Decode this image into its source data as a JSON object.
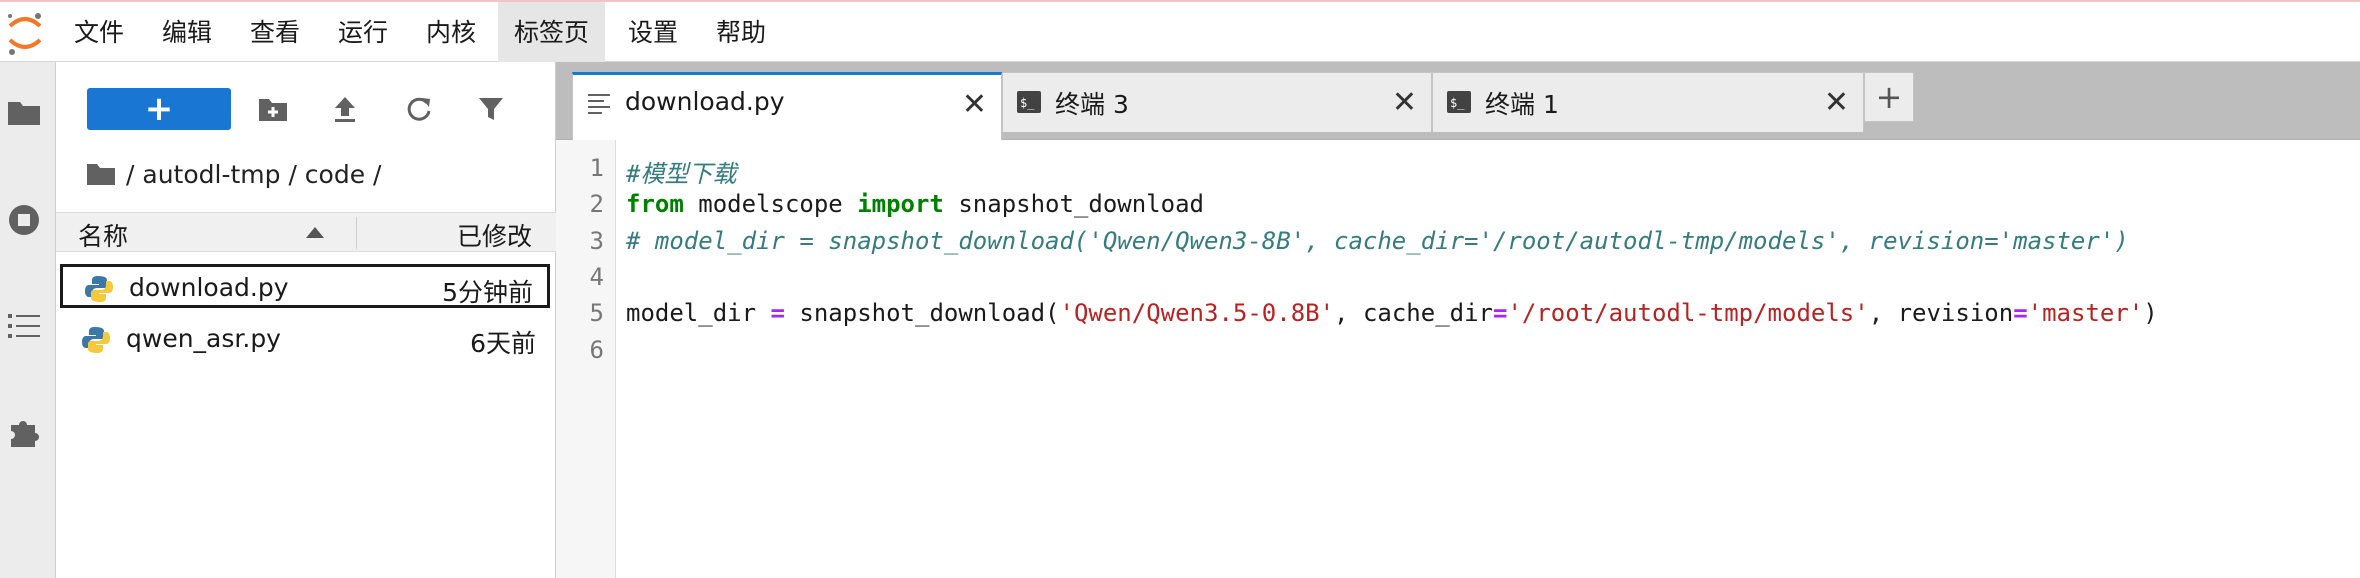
{
  "menubar": {
    "items": [
      "文件",
      "编辑",
      "查看",
      "运行",
      "内核",
      "标签页",
      "设置",
      "帮助"
    ],
    "active_index": 5
  },
  "filebrowser": {
    "new_button_label": "+",
    "breadcrumb": "/ autodl-tmp / code /",
    "header": {
      "name": "名称",
      "modified": "已修改"
    },
    "files": [
      {
        "name": "download.py",
        "modified": "5分钟前",
        "icon": "python-icon",
        "selected": true
      },
      {
        "name": "qwen_asr.py",
        "modified": "6天前",
        "icon": "python-icon",
        "selected": false
      }
    ]
  },
  "tabs": [
    {
      "label": "download.py",
      "icon": "text-file-icon",
      "active": true
    },
    {
      "label": "终端 3",
      "icon": "terminal-icon",
      "active": false
    },
    {
      "label": "终端 1",
      "icon": "terminal-icon",
      "active": false
    }
  ],
  "tab_close_glyph": "✕",
  "tab_add_glyph": "+",
  "editor": {
    "line_numbers": [
      "1",
      "2",
      "3",
      "4",
      "5",
      "6"
    ],
    "lines": [
      {
        "parts": [
          {
            "t": "#模型下载",
            "c": "comment"
          }
        ]
      },
      {
        "parts": [
          {
            "t": "from",
            "c": "kw"
          },
          {
            "t": " modelscope ",
            "c": ""
          },
          {
            "t": "import",
            "c": "kw"
          },
          {
            "t": " snapshot_download",
            "c": ""
          }
        ]
      },
      {
        "parts": [
          {
            "t": "# model_dir = snapshot_download('Qwen/Qwen3-8B', cache_dir='/root/autodl-tmp/models', revision='master')",
            "c": "comment"
          }
        ]
      },
      {
        "parts": []
      },
      {
        "parts": [
          {
            "t": "model_dir ",
            "c": ""
          },
          {
            "t": "=",
            "c": "op"
          },
          {
            "t": " snapshot_download(",
            "c": ""
          },
          {
            "t": "'Qwen/Qwen3.5-0.8B'",
            "c": "str"
          },
          {
            "t": ", cache_dir",
            "c": ""
          },
          {
            "t": "=",
            "c": "op"
          },
          {
            "t": "'/root/autodl-tmp/models'",
            "c": "str"
          },
          {
            "t": ", revision",
            "c": ""
          },
          {
            "t": "=",
            "c": "op"
          },
          {
            "t": "'master'",
            "c": "str"
          },
          {
            "t": ")",
            "c": ""
          }
        ]
      },
      {
        "parts": []
      }
    ]
  },
  "colors": {
    "accent": "#1976d2",
    "comment": "#347c80",
    "keyword": "#008000",
    "string": "#ba2121",
    "operator": "#aa22ff"
  }
}
